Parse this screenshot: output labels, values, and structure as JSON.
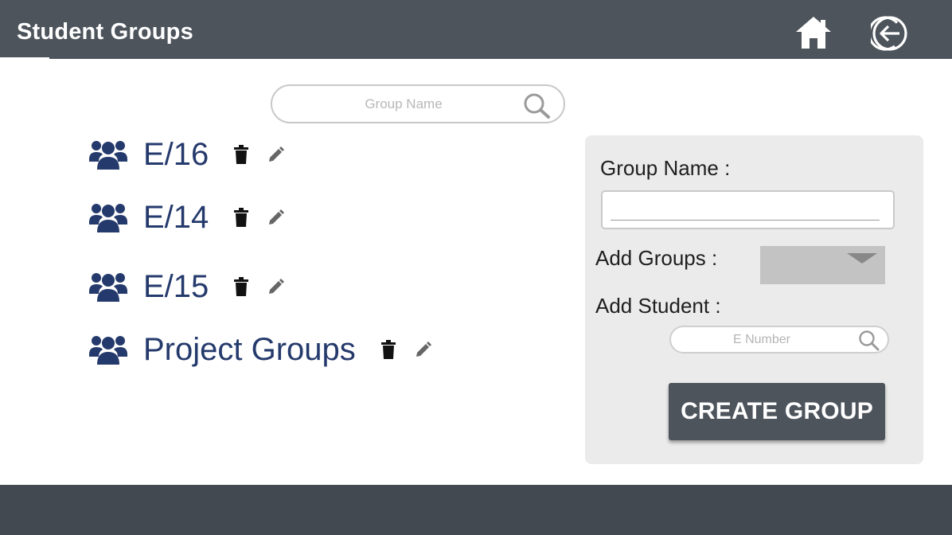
{
  "header": {
    "title": "Student Groups",
    "home_icon": "home-icon",
    "logout_icon": "logout-icon"
  },
  "search": {
    "placeholder": "Group Name",
    "icon": "search-icon"
  },
  "groups": [
    {
      "name": "E/16",
      "icon": "users-icon"
    },
    {
      "name": "E/14",
      "icon": "users-icon"
    },
    {
      "name": "E/15",
      "icon": "users-icon"
    },
    {
      "name": "Project Groups",
      "icon": "users-icon"
    }
  ],
  "create_panel": {
    "group_name_label": "Group Name :",
    "group_name_value": "",
    "add_groups_label": "Add Groups :",
    "add_student_label": "Add Student :",
    "student_search_placeholder": "E Number",
    "create_button_label": "CREATE GROUP"
  },
  "colors": {
    "header_bg": "#4d545c",
    "group_name": "#253a6c",
    "panel_bg": "#ebebeb",
    "footer_bg": "#424950"
  }
}
